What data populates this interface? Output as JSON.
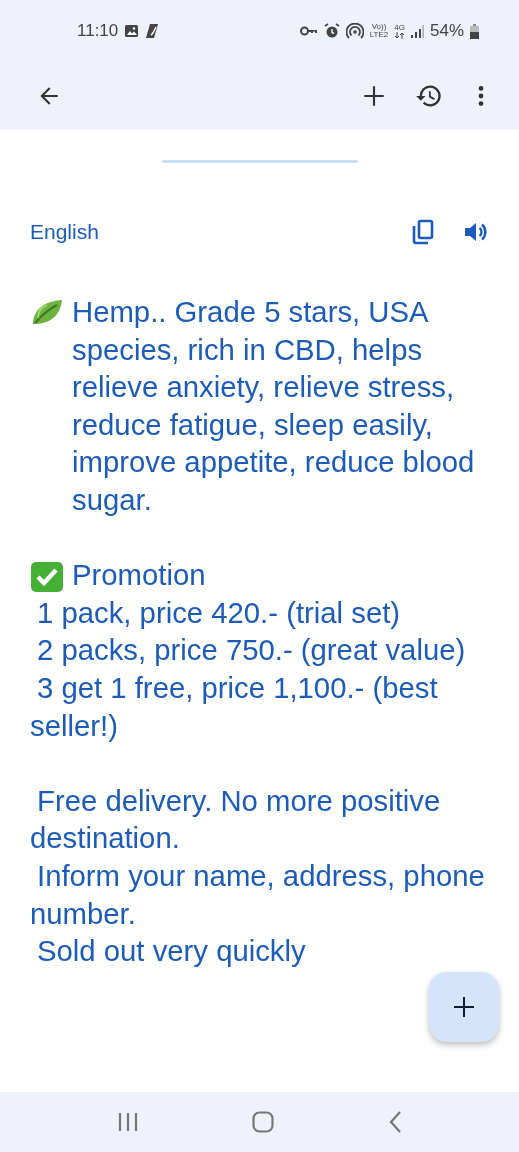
{
  "status_bar": {
    "time": "11:10",
    "volte_top": "Vo))",
    "volte_bottom": "LTE2",
    "network": "4G",
    "battery": "54%"
  },
  "translation": {
    "language": "English",
    "paragraphs": [
      {
        "kind": "leaf",
        "lines": [
          "Hemp.. Grade 5 stars, USA species, rich in CBD, helps relieve anxiety, relieve stress, reduce fatigue, sleep easily, improve appetite, reduce blood sugar."
        ]
      },
      {
        "kind": "check",
        "lines": [
          "Promotion",
          "1 pack, price 420.- (trial set)",
          "2 packs, price 750.- (great value)",
          "3 get 1 free, price 1,100.- (best seller!)"
        ]
      },
      {
        "kind": "plain",
        "lines": [
          "Free delivery. No more positive destination.",
          "Inform your name, address, phone number.",
          "Sold out very quickly"
        ]
      }
    ]
  }
}
